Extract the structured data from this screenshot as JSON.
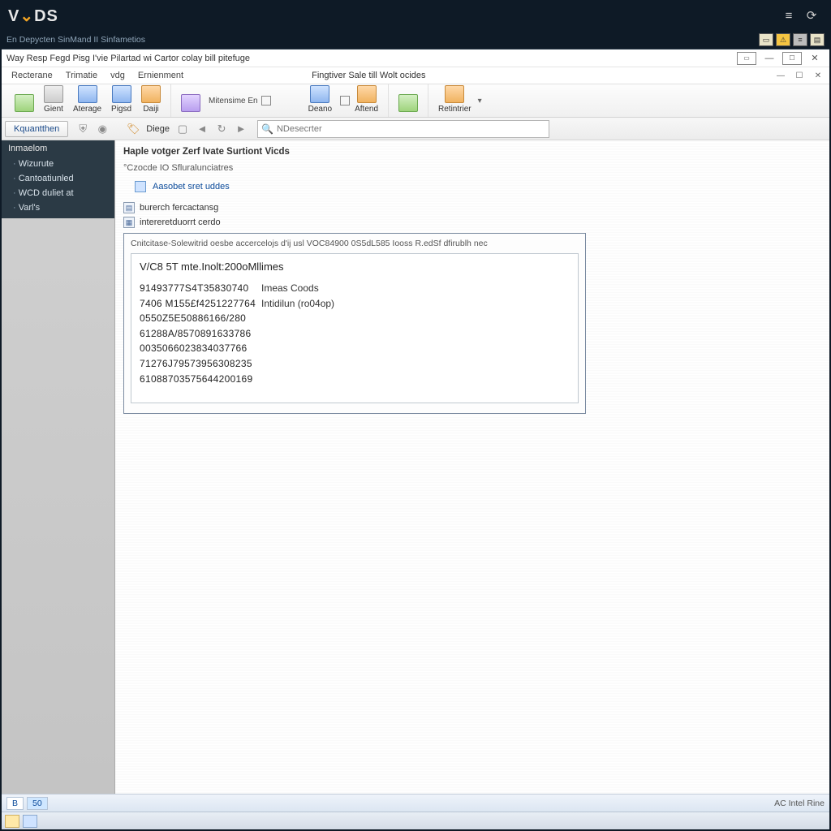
{
  "outer": {
    "logo_prefix": "V",
    "logo_rest": "DS",
    "subtitle": "En Depycten SinMand II Sinfametios",
    "ctrl_menu": "≡",
    "ctrl_user": "⟳"
  },
  "inner_window": {
    "title": "Way Resp Fegd Pisg   I'vie Pilartad wi Cartor colay bill pitefuge"
  },
  "menu": {
    "items": [
      "Recterane",
      "Trimatie",
      "vdg",
      "Ernienment"
    ],
    "right_title": "Fingtiver Sale till Wolt ocides"
  },
  "ribbon": {
    "g1": [
      {
        "label": "",
        "style": "green"
      },
      {
        "label": "Gient",
        "style": "gray"
      },
      {
        "label": "Aterage",
        "style": "blue"
      },
      {
        "label": "Pigsd",
        "style": "blue"
      },
      {
        "label": "Daiji",
        "style": "orange"
      }
    ],
    "g2_label": "Mitensime En",
    "g2b": [
      {
        "label": "Deano",
        "style": "blue"
      },
      {
        "label": "Aftend",
        "style": "orange"
      }
    ],
    "g3": [
      {
        "label": "",
        "style": "green"
      }
    ],
    "g4": [
      {
        "label": "Retintrier",
        "style": "orange"
      }
    ]
  },
  "toolbar2": {
    "tab": "Kquantthen",
    "disc_label": "Diege",
    "search_placeholder": "NDesecrter"
  },
  "sidebar": {
    "header": "Inmaelom",
    "items": [
      "Wizurute",
      "Cantoatiunled",
      "WCD duliet at",
      "Varl's"
    ]
  },
  "content": {
    "title": "Haple votger Zerf Ivate Surtiont Vicds",
    "subtitle": "°Czocde IO Sfluralunciatres",
    "action": "Aasobet sret uddes",
    "cat1": "burerch fercactansg",
    "cat2": "intereretduorrt cerdo"
  },
  "panel": {
    "caption": "Cnitcitase-Solewitrid oesbe accercelojs d'ij usl VOC84900 0S5dL585 Iooss R.edSf dfirublh nec",
    "title": "V/C8 5T mte.Inolt:200oMllimes",
    "rows": [
      {
        "code": "91493777S4T35830740",
        "label": "Imeas Coods"
      },
      {
        "code": "7406 M155£f4251227764",
        "label": "Intidilun (ro04op)"
      },
      {
        "code": "0550Z5E50886166/280",
        "label": ""
      },
      {
        "code": "61288A/8570891633786",
        "label": ""
      },
      {
        "code": "0035066023834037766",
        "label": ""
      },
      {
        "code": "71276J79573956308235",
        "label": ""
      },
      {
        "code": "61088703575644200169",
        "label": ""
      }
    ]
  },
  "status": {
    "chip1": "B",
    "chip2": "50",
    "right": "AC Intel Rine"
  }
}
